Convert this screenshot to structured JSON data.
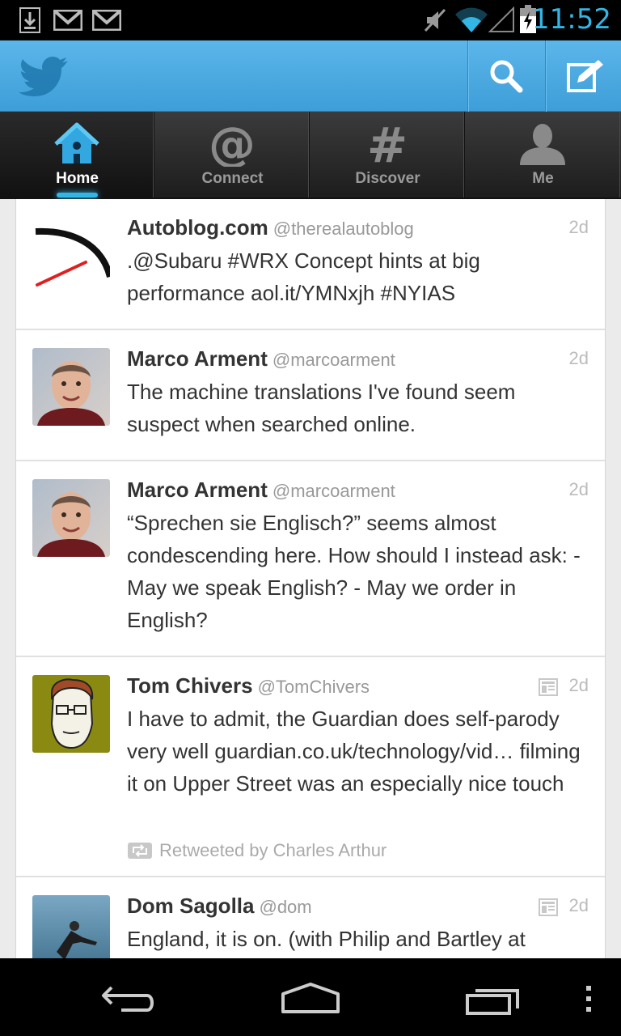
{
  "status_bar": {
    "time": "11:52",
    "icons": [
      "download-icon",
      "gmail-icon",
      "gmail-icon",
      "mute-icon",
      "wifi-icon",
      "signal-icon",
      "battery-charging-icon"
    ]
  },
  "action_bar": {
    "logo": "twitter-bird-icon",
    "actions": [
      "search-icon",
      "compose-icon"
    ]
  },
  "tabs": [
    {
      "label": "Home",
      "icon": "home-icon",
      "active": true
    },
    {
      "label": "Connect",
      "icon": "at-icon",
      "active": false
    },
    {
      "label": "Discover",
      "icon": "hash-icon",
      "active": false
    },
    {
      "label": "Me",
      "icon": "person-icon",
      "active": false
    }
  ],
  "tweets": [
    {
      "name": "Autoblog.com",
      "handle": "@therealautoblog",
      "time": "2d",
      "text": ".@Subaru #WRX Concept hints at big performance aol.it/YMNxjh #NYIAS",
      "has_media": false,
      "retweet": ""
    },
    {
      "name": "Marco Arment",
      "handle": "@marcoarment",
      "time": "2d",
      "text": "The machine translations I've found seem suspect when searched online.",
      "has_media": false,
      "retweet": ""
    },
    {
      "name": "Marco Arment",
      "handle": "@marcoarment",
      "time": "2d",
      "text": "“Sprechen sie Englisch?” seems almost condescending here. How should I instead ask: - May we speak English? - May we order in English?",
      "has_media": false,
      "retweet": ""
    },
    {
      "name": "Tom Chivers",
      "handle": "@TomChivers",
      "time": "2d",
      "text": "I have to admit, the Guardian does self-parody very well guardian.co.uk/technology/vid… filming it on Upper Street was an especially nice touch",
      "has_media": true,
      "retweet": "Retweeted by Charles Arthur"
    },
    {
      "name": "Dom Sagolla",
      "handle": "@dom",
      "time": "2d",
      "text": "England, it is on. (with Philip and Bartley at",
      "has_media": true,
      "retweet": ""
    }
  ],
  "nav_bar": {
    "buttons": [
      "back-icon",
      "home-nav-icon",
      "recents-icon",
      "menu-icon"
    ]
  },
  "colors": {
    "action_bar": "#4aa8e0",
    "accent": "#33b5e5",
    "tab_bar": "#2b2b2b"
  }
}
